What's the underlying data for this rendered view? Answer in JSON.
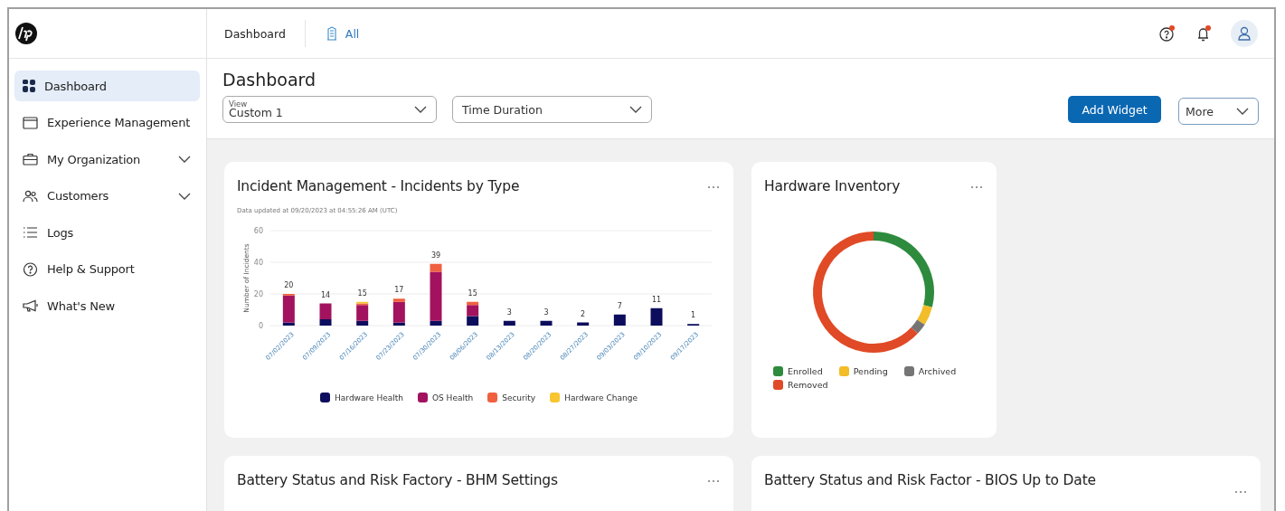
{
  "topbar": {
    "breadcrumb": "Dashboard",
    "scope": "All"
  },
  "sidebar": {
    "items": [
      {
        "label": "Dashboard",
        "selected": true,
        "expandable": false
      },
      {
        "label": "Experience Management",
        "selected": false,
        "expandable": false
      },
      {
        "label": "My Organization",
        "selected": false,
        "expandable": true
      },
      {
        "label": "Customers",
        "selected": false,
        "expandable": true
      },
      {
        "label": "Logs",
        "selected": false,
        "expandable": false
      },
      {
        "label": "Help & Support",
        "selected": false,
        "expandable": false
      },
      {
        "label": "What's New",
        "selected": false,
        "expandable": false
      }
    ]
  },
  "page": {
    "title": "Dashboard",
    "view": {
      "label": "View",
      "value": "Custom 1"
    },
    "time": {
      "placeholder": "Time Duration"
    },
    "buttons": [
      {
        "label": "Add Widget",
        "kind": "primary"
      },
      {
        "label": "More",
        "kind": "dropdown"
      }
    ]
  },
  "widgets": [
    {
      "kind": "bar",
      "title": "Incident Management - Incidents by Type",
      "subtitle": "Data updated at 09/20/2023 at 04:55:26 AM (UTC)",
      "chart_data": {
        "type": "bar",
        "ylabel": "Number of Incidents",
        "stacked": true,
        "ylim": [
          0,
          60
        ],
        "yticks": [
          0,
          20,
          40,
          60
        ],
        "categories": [
          "07/02/2023",
          "07/09/2023",
          "07/16/2023",
          "07/23/2023",
          "07/30/2023",
          "08/06/2023",
          "08/13/2023",
          "08/20/2023",
          "08/27/2023",
          "09/03/2023",
          "09/10/2023",
          "09/17/2023"
        ],
        "series": [
          {
            "name": "Hardware Health",
            "color": "#0d0d5e",
            "values": [
              2,
              4,
              3,
              2,
              3,
              6,
              3,
              3,
              2,
              7,
              11,
              1
            ]
          },
          {
            "name": "OS Health",
            "color": "#a3125e",
            "values": [
              17,
              10,
              10,
              13,
              31,
              7,
              0,
              0,
              0,
              0,
              0,
              0
            ]
          },
          {
            "name": "Security",
            "color": "#f0603e",
            "values": [
              1,
              0,
              1,
              2,
              5,
              2,
              0,
              0,
              0,
              0,
              0,
              0
            ]
          },
          {
            "name": "Hardware Change",
            "color": "#f7c631",
            "values": [
              0,
              0,
              1,
              0,
              0,
              0,
              0,
              0,
              0,
              0,
              0,
              0
            ]
          }
        ],
        "value_labels": [
          "20",
          "14",
          "15",
          "17",
          "39",
          "15",
          "3",
          "3",
          "2",
          "7",
          "11",
          "1"
        ]
      }
    },
    {
      "kind": "donut",
      "title": "Hardware Inventory",
      "legend": [
        {
          "label": "Enrolled",
          "color": "#2e8b3e"
        },
        {
          "label": "Pending",
          "color": "#f2bd29"
        },
        {
          "label": "Archived",
          "color": "#757575"
        },
        {
          "label": "Removed",
          "color": "#e04a26"
        }
      ]
    },
    {
      "kind": "empty",
      "title": "Battery Status and Risk Factory - BHM Settings"
    },
    {
      "kind": "empty",
      "title": "Battery Status and Risk Factor - BIOS Up to Date"
    }
  ]
}
